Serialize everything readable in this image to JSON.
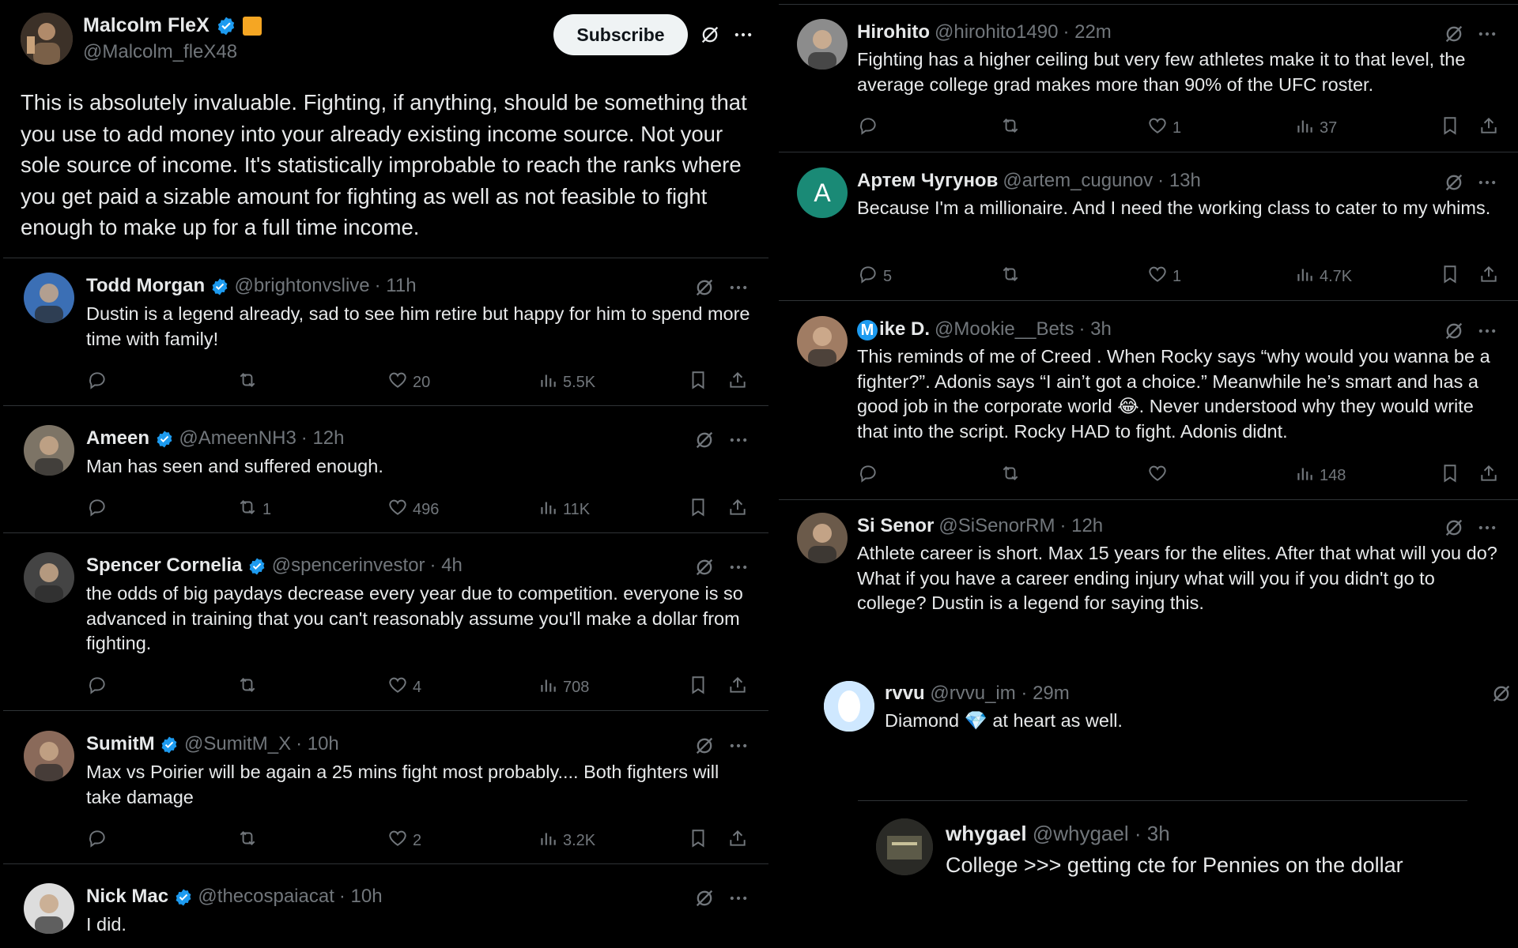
{
  "main_post": {
    "name": "Malcolm FleX",
    "handle": "@Malcolm_fleX48",
    "subscribe_label": "Subscribe",
    "text": "This is absolutely invaluable. Fighting, if anything, should be something that you use to add money into your already existing income source. Not your sole source of income. It's statistically improbable to reach the ranks where you get paid a sizable amount for fighting as well as not feasible to fight enough to make up for a full time income."
  },
  "left_replies": [
    {
      "name": "Todd Morgan",
      "handle": "@brightonvslive",
      "time": "· 11h",
      "text": "Dustin is a legend already, sad to see him retire but happy for him to spend more time with family!",
      "retweets": "",
      "likes": "20",
      "views": "5.5K",
      "avatar_color": "#3b6fb5"
    },
    {
      "name": "Ameen",
      "handle": "@AmeenNH3",
      "time": "· 12h",
      "text": "Man has seen and suffered enough.",
      "retweets": "1",
      "likes": "496",
      "views": "11K",
      "avatar_color": "#7d7466"
    },
    {
      "name": "Spencer Cornelia",
      "handle": "@spencerinvestor",
      "time": "· 4h",
      "text": "the odds of big paydays decrease every year due to competition. everyone is so advanced in training that you can't reasonably assume you'll make a dollar from fighting.",
      "retweets": "",
      "likes": "4",
      "views": "708",
      "avatar_color": "#444444"
    },
    {
      "name": "SumitM",
      "handle": "@SumitM_X",
      "time": "· 10h",
      "text": "Max vs Poirier will be again a 25 mins fight most probably.... Both fighters will take damage",
      "retweets": "",
      "likes": "2",
      "views": "3.2K",
      "avatar_color": "#8a6a5a"
    },
    {
      "name": "Nick Mac",
      "handle": "@thecospaiacat",
      "time": "· 10h",
      "text": "I did.",
      "retweets": "",
      "likes": "",
      "views": "",
      "avatar_color": "#dddddd"
    }
  ],
  "right_replies": [
    {
      "name": "Hirohito",
      "handle": "@hirohito1490",
      "time": "· 22m",
      "text": "Fighting has a higher ceiling but very few athletes make it to that level, the average college grad makes more than 90% of the UFC roster.",
      "replies": "",
      "likes": "1",
      "views": "37",
      "avatar_color": "#8c8c8c"
    },
    {
      "name": "Артем Чугунов",
      "handle": "@artem_cugunov",
      "time": "· 13h",
      "text": "Because I'm a millionaire. And I need the working class to cater to my whims.",
      "replies": "5",
      "likes": "1",
      "views": "4.7K",
      "avatar_color": "#1a8a76",
      "avatar_letter": "A"
    },
    {
      "name": "ike D.",
      "name_badge": "M",
      "handle": "@Mookie__Bets",
      "time": "· 3h",
      "text": "This reminds of me of Creed . When Rocky says “why would you wanna be a fighter?”. Adonis says “I ain’t got a choice.” Meanwhile he’s smart and has a good job in the corporate world 😂. Never understood why they would write that into the script. Rocky HAD to fight. Adonis didnt.",
      "replies": "",
      "likes": "",
      "views": "148",
      "avatar_color": "#a07c63"
    },
    {
      "name": "Si Senor",
      "handle": "@SiSenorRM",
      "time": "· 12h",
      "text": "Athlete career is short. Max 15 years  for the elites. After that what will you do? What if you have a career ending injury what will you if you didn't go to college? Dustin is a legend for saying this.",
      "avatar_color": "#6b5a4a"
    }
  ],
  "nested_reply": {
    "name": "rvvu",
    "handle": "@rvvu_im",
    "time": "· 29m",
    "text": "Diamond 💎 at heart as well."
  },
  "quote_reply": {
    "name": "whygael",
    "handle": "@whygael",
    "time": "· 3h",
    "text": "College >>> getting cte for Pennies on the dollar"
  },
  "colors": {
    "background": "#000000",
    "text": "#e7e9ea",
    "muted": "#71767b",
    "verified": "#1d9bf0",
    "divider": "#2f3336"
  }
}
